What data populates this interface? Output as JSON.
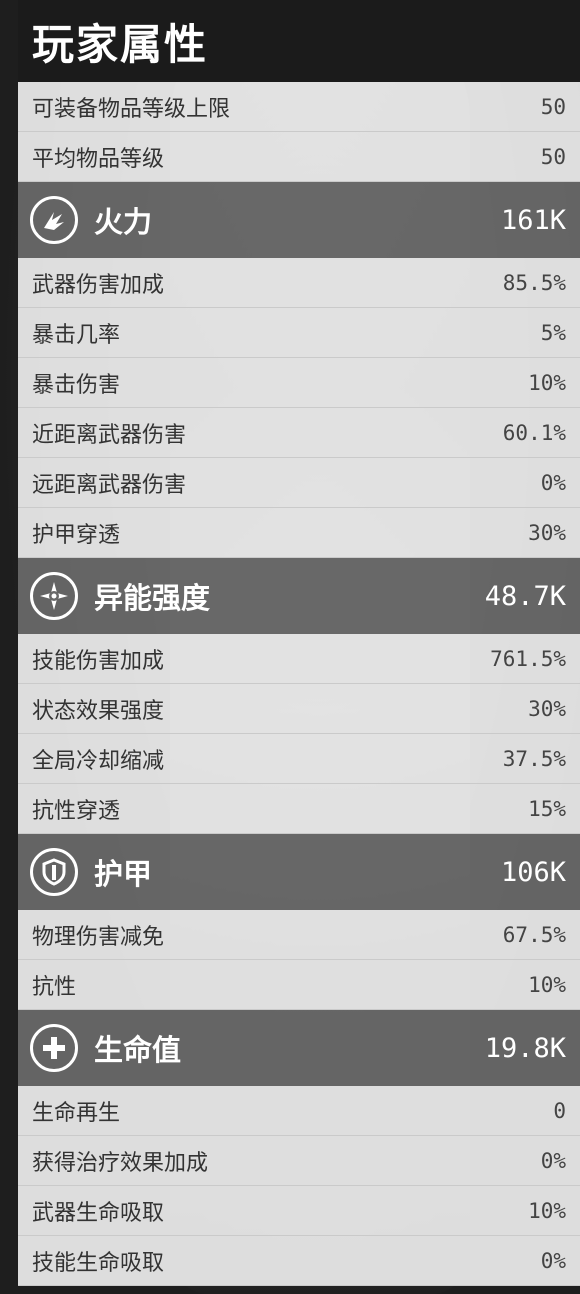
{
  "title": "玩家属性",
  "general": [
    {
      "label": "可装备物品等级上限",
      "value": "50"
    },
    {
      "label": "平均物品等级",
      "value": "50"
    }
  ],
  "sections": [
    {
      "name": "火力",
      "total": "161K",
      "icon": "firepower-icon",
      "rows": [
        {
          "label": "武器伤害加成",
          "value": "85.5%"
        },
        {
          "label": "暴击几率",
          "value": "5%"
        },
        {
          "label": "暴击伤害",
          "value": "10%"
        },
        {
          "label": "近距离武器伤害",
          "value": "60.1%"
        },
        {
          "label": "远距离武器伤害",
          "value": "0%"
        },
        {
          "label": "护甲穿透",
          "value": "30%"
        }
      ]
    },
    {
      "name": "异能强度",
      "total": "48.7K",
      "icon": "anomaly-power-icon",
      "rows": [
        {
          "label": "技能伤害加成",
          "value": "761.5%"
        },
        {
          "label": "状态效果强度",
          "value": "30%"
        },
        {
          "label": "全局冷却缩减",
          "value": "37.5%"
        },
        {
          "label": "抗性穿透",
          "value": "15%"
        }
      ]
    },
    {
      "name": "护甲",
      "total": "106K",
      "icon": "shield-icon",
      "rows": [
        {
          "label": "物理伤害减免",
          "value": "67.5%"
        },
        {
          "label": "抗性",
          "value": "10%"
        }
      ]
    },
    {
      "name": "生命值",
      "total": "19.8K",
      "icon": "health-plus-icon",
      "rows": [
        {
          "label": "生命再生",
          "value": "0"
        },
        {
          "label": "获得治疗效果加成",
          "value": "0%"
        },
        {
          "label": "武器生命吸取",
          "value": "10%"
        },
        {
          "label": "技能生命吸取",
          "value": "0%"
        }
      ]
    }
  ]
}
